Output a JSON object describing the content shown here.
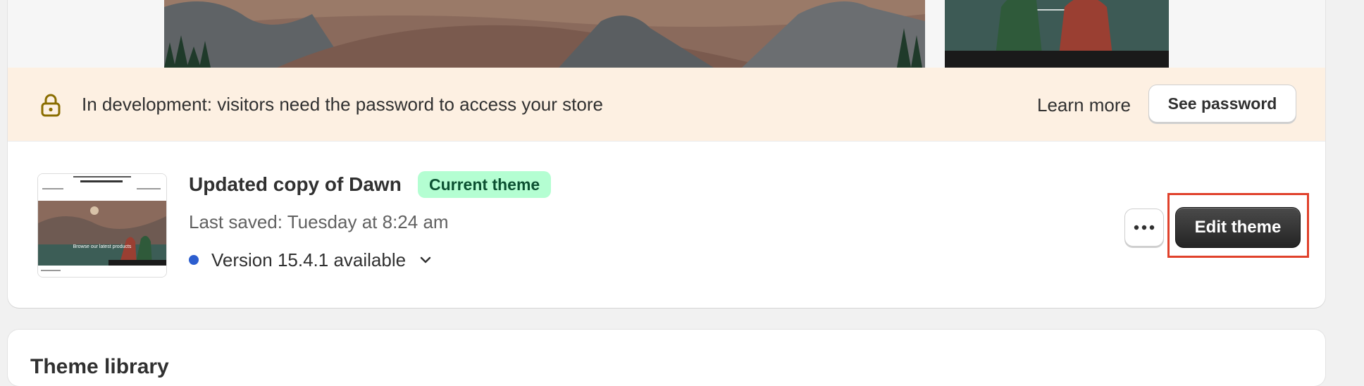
{
  "banner": {
    "text": "In development: visitors need the password to access your store",
    "learn_more": "Learn more",
    "see_password": "See password"
  },
  "theme": {
    "name": "Updated copy of Dawn",
    "badge": "Current theme",
    "last_saved": "Last saved: Tuesday at 8:24 am",
    "version": "Version 15.4.1 available",
    "edit_button": "Edit theme",
    "thumbnail_caption": "Browse our latest products"
  },
  "library": {
    "title": "Theme library"
  },
  "colors": {
    "banner_bg": "#fdf0e2",
    "badge_bg": "#b4fed2",
    "badge_text": "#0c5132",
    "version_dot": "#2c5ecf",
    "primary_button": "#303030",
    "highlight": "#e0412b"
  },
  "icons": {
    "lock": "lock-icon",
    "version_toggle": "chevron-down-icon",
    "more": "ellipsis-icon"
  }
}
